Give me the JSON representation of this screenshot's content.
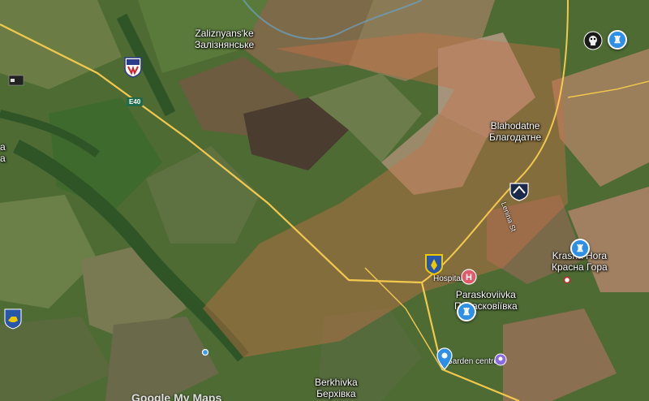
{
  "places": {
    "zaliznyanske": {
      "latin": "Zaliznyans'ke",
      "cyrillic": "Залізнянське"
    },
    "blahodatne": {
      "latin": "Blahodatne",
      "cyrillic": "Благодатне"
    },
    "krasna_hora": {
      "latin": "Krasna Hora",
      "cyrillic": "Красна Гора"
    },
    "paraskoviivka": {
      "latin": "Paraskoviivka",
      "cyrillic": "Парасковіївка"
    },
    "berkhivka": {
      "latin": "Berkhivka",
      "cyrillic": "Берхівка"
    },
    "left_partial": {
      "latin": "a",
      "cyrillic": "a"
    }
  },
  "road": {
    "shield": "E40"
  },
  "street": {
    "lenina": "Lenina St"
  },
  "poi": {
    "hospital": "Hospital",
    "garden_centre": "Garden centre"
  },
  "icons": {
    "unit_emblem": "military-unit-emblem-icon",
    "wagner": "wagner-skull-icon",
    "coat_of_arms": "coat-of-arms-icon",
    "hospital": "hospital-icon",
    "tower": "tower-icon",
    "location_pin": "location-pin-icon",
    "garden": "garden-centre-icon"
  },
  "colors": {
    "roads": "#f2c94c",
    "pin": "#2e8fe6",
    "hospital": "#e05a6a",
    "russian_zone": "#c8704a"
  },
  "watermark": "Google My Maps"
}
